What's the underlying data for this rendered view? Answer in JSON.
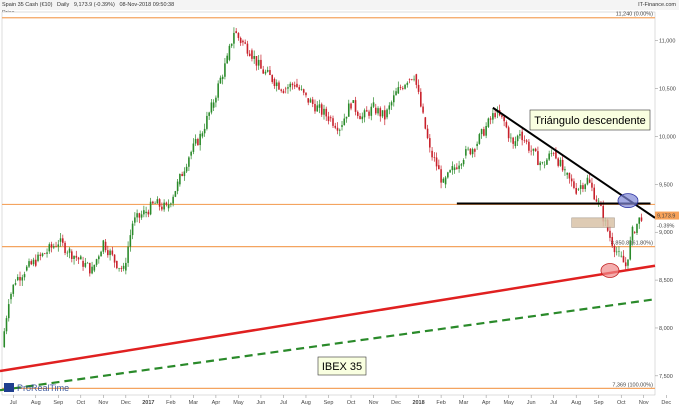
{
  "header": {
    "instrument": "Spain 35 Cash (€10)",
    "period": "Daily",
    "quote": "9,173.9 (-0.39%)",
    "datetime": "08-Nov-2018 09:50:38",
    "source": "IT-Finance.com"
  },
  "price_tag_label": "Price",
  "watermark": "ProRealTime",
  "colors": {
    "up": "#2a8a2a",
    "down": "#c8202a",
    "fib_line": "#f4a460",
    "support": "#e02020",
    "parallel": "#2a8a2a",
    "trendline": "#000000",
    "rect_fill": "#d9c3a8",
    "circle_blue": "#7d86d6",
    "circle_red": "#f08a8a",
    "label_box_bg": "#f9ffe0"
  },
  "chart_data": {
    "type": "candlestick",
    "x_tick_labels": [
      "Jul",
      "Aug",
      "Sep",
      "Oct",
      "Nov",
      "Dec",
      "2017",
      "Feb",
      "Mar",
      "Apr",
      "May",
      "Jun",
      "Jul",
      "Aug",
      "Sep",
      "Oct",
      "Nov",
      "Dec",
      "2018",
      "Feb",
      "Mar",
      "Apr",
      "May",
      "Jun",
      "Jul",
      "Aug",
      "Sep",
      "Oct",
      "Nov",
      "Dec"
    ],
    "y_ticks": [
      7500,
      8000,
      8500,
      9000,
      9500,
      10000,
      10500,
      11000
    ],
    "y_tick_labels": [
      "7,500",
      "8,000",
      "8,500",
      "9,000",
      "9,500",
      "10,000",
      "10,500",
      "11,000"
    ],
    "ylim": [
      7300,
      11300
    ],
    "xlim": [
      0,
      29
    ],
    "price_series": [
      [
        0,
        7800
      ],
      [
        0.3,
        8300
      ],
      [
        0.6,
        8500
      ],
      [
        1.0,
        8600
      ],
      [
        1.5,
        8700
      ],
      [
        2.0,
        8800
      ],
      [
        2.5,
        8900
      ],
      [
        3.0,
        8800
      ],
      [
        3.5,
        8700
      ],
      [
        4.0,
        8600
      ],
      [
        4.5,
        8900
      ],
      [
        5.0,
        8700
      ],
      [
        5.4,
        8600
      ],
      [
        5.8,
        9100
      ],
      [
        6.3,
        9200
      ],
      [
        6.8,
        9300
      ],
      [
        7.3,
        9250
      ],
      [
        7.8,
        9500
      ],
      [
        8.3,
        9800
      ],
      [
        8.8,
        10000
      ],
      [
        9.3,
        10300
      ],
      [
        9.7,
        10600
      ],
      [
        10.0,
        10800
      ],
      [
        10.3,
        11100
      ],
      [
        10.6,
        11000
      ],
      [
        11.0,
        10900
      ],
      [
        11.5,
        10700
      ],
      [
        12.0,
        10600
      ],
      [
        12.5,
        10500
      ],
      [
        13.0,
        10550
      ],
      [
        13.5,
        10400
      ],
      [
        14.0,
        10300
      ],
      [
        14.5,
        10200
      ],
      [
        15.0,
        10100
      ],
      [
        15.5,
        10350
      ],
      [
        16.0,
        10200
      ],
      [
        16.5,
        10300
      ],
      [
        17.0,
        10200
      ],
      [
        17.5,
        10450
      ],
      [
        18.0,
        10600
      ],
      [
        18.3,
        10650
      ],
      [
        18.7,
        10200
      ],
      [
        19.0,
        9850
      ],
      [
        19.3,
        9700
      ],
      [
        19.6,
        9500
      ],
      [
        20.0,
        9650
      ],
      [
        20.5,
        9800
      ],
      [
        21.0,
        9900
      ],
      [
        21.5,
        10100
      ],
      [
        21.9,
        10250
      ],
      [
        22.3,
        10150
      ],
      [
        22.7,
        9900
      ],
      [
        23.0,
        10050
      ],
      [
        23.5,
        9850
      ],
      [
        24.0,
        9700
      ],
      [
        24.5,
        9850
      ],
      [
        25.0,
        9600
      ],
      [
        25.5,
        9450
      ],
      [
        26.0,
        9550
      ],
      [
        26.5,
        9300
      ],
      [
        27.0,
        8950
      ],
      [
        27.4,
        8750
      ],
      [
        27.7,
        8650
      ],
      [
        28.0,
        9000
      ],
      [
        28.4,
        9174
      ]
    ],
    "horizontal_levels": [
      {
        "value": 11240,
        "label": "11,240 (0.00%)"
      },
      {
        "value": 9290,
        "label": ""
      },
      {
        "value": 8850,
        "label": "8,850.8 (61.80%)"
      },
      {
        "value": 7369,
        "label": "7,369 (100.00%)"
      }
    ],
    "current_price": {
      "value": 9173.9,
      "label": "9,173.9",
      "change_label": "-0.39%"
    },
    "annotations": [
      {
        "text": "Triángulo descendente"
      },
      {
        "text": "IBEX 35"
      }
    ]
  }
}
